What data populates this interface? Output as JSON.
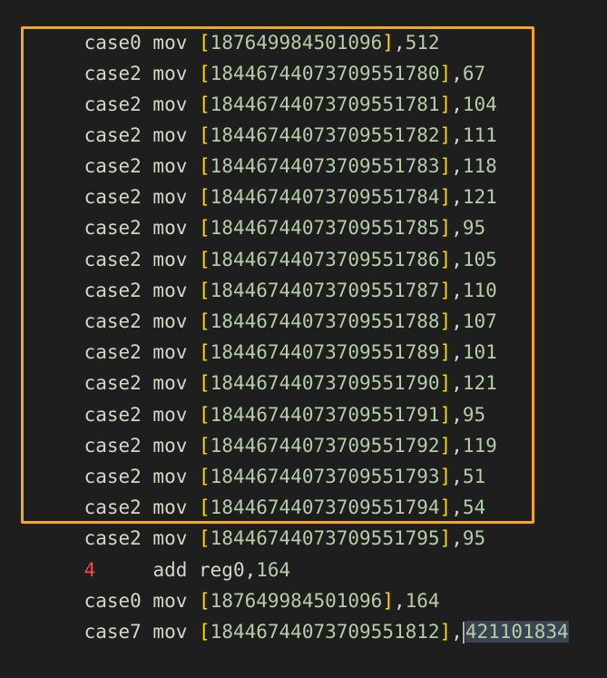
{
  "editor": {
    "lines": [
      {
        "prefix": "case0 mov ",
        "addr": "187649984501096",
        "value": "512"
      },
      {
        "prefix": "case2 mov ",
        "addr": "18446744073709551780",
        "value": "67"
      },
      {
        "prefix": "case2 mov ",
        "addr": "18446744073709551781",
        "value": "104"
      },
      {
        "prefix": "case2 mov ",
        "addr": "18446744073709551782",
        "value": "111"
      },
      {
        "prefix": "case2 mov ",
        "addr": "18446744073709551783",
        "value": "118"
      },
      {
        "prefix": "case2 mov ",
        "addr": "18446744073709551784",
        "value": "121"
      },
      {
        "prefix": "case2 mov ",
        "addr": "18446744073709551785",
        "value": "95"
      },
      {
        "prefix": "case2 mov ",
        "addr": "18446744073709551786",
        "value": "105"
      },
      {
        "prefix": "case2 mov ",
        "addr": "18446744073709551787",
        "value": "110"
      },
      {
        "prefix": "case2 mov ",
        "addr": "18446744073709551788",
        "value": "107"
      },
      {
        "prefix": "case2 mov ",
        "addr": "18446744073709551789",
        "value": "101"
      },
      {
        "prefix": "case2 mov ",
        "addr": "18446744073709551790",
        "value": "121"
      },
      {
        "prefix": "case2 mov ",
        "addr": "18446744073709551791",
        "value": "95"
      },
      {
        "prefix": "case2 mov ",
        "addr": "18446744073709551792",
        "value": "119"
      },
      {
        "prefix": "case2 mov ",
        "addr": "18446744073709551793",
        "value": "51"
      },
      {
        "prefix": "case2 mov ",
        "addr": "18446744073709551794",
        "value": "54"
      },
      {
        "prefix": "case2 mov ",
        "addr": "18446744073709551795",
        "value": "95"
      }
    ],
    "add_line": {
      "label": "4",
      "spacer": "     ",
      "instr": "add reg0,",
      "value": "164"
    },
    "tail_lines": [
      {
        "prefix": "case0 mov ",
        "addr": "187649984501096",
        "value": "164"
      }
    ],
    "last_line": {
      "prefix": "case7 mov ",
      "addr": "18446744073709551812",
      "selected_value": "421101834"
    },
    "syntax_colors": {
      "text": "#d6d6c8",
      "number": "#b5cea8",
      "bracket": "#ffd700",
      "label_red": "#f44747",
      "highlight_box": "#f5a623",
      "selection": "#3a4350"
    }
  }
}
